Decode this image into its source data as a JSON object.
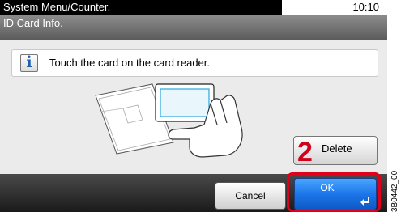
{
  "statusbar": {
    "title": "System Menu/Counter.",
    "time": "10:10"
  },
  "header": {
    "title": "ID Card Info."
  },
  "message": {
    "icon": "info-icon",
    "text": "Touch the card on the card reader."
  },
  "illustration": {
    "icon": "hand-touch-card-reader-icon"
  },
  "buttons": {
    "delete": "Delete",
    "cancel": "Cancel",
    "ok": "OK"
  },
  "annotation": {
    "step": "2",
    "highlight_color": "#e0001b"
  },
  "figure_code": "3B0442_00",
  "colors": {
    "ok_button": "#1c76ea",
    "status_title_bg": "#000000",
    "header_bg": "#7a7a7a"
  }
}
